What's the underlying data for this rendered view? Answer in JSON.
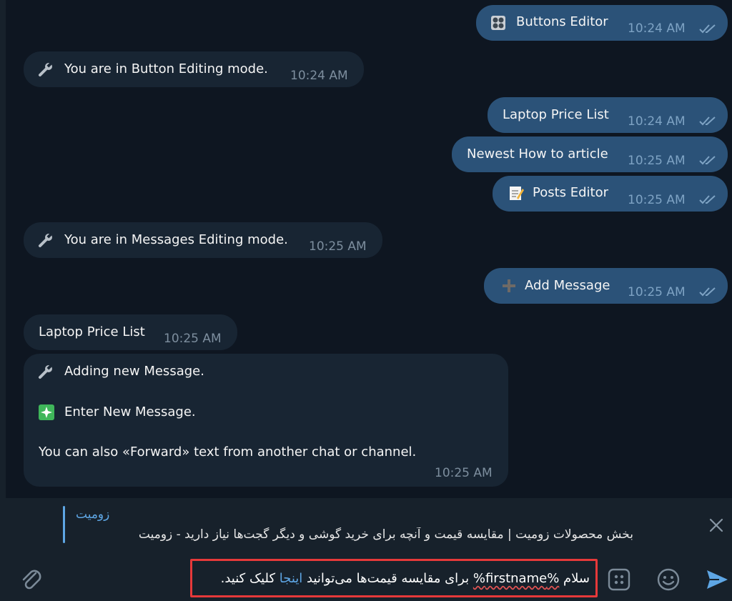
{
  "messages": {
    "buttons_editor": {
      "label": "Buttons Editor",
      "time": "10:24 AM",
      "icon": "control-knobs-icon"
    },
    "button_mode": {
      "label": "You are in Button Editing mode.",
      "time": "10:24 AM",
      "icon": "wrench-icon"
    },
    "laptop_out": {
      "label": "Laptop Price List",
      "time": "10:24 AM"
    },
    "howto": {
      "label": "Newest How to article",
      "time": "10:25 AM"
    },
    "posts_editor": {
      "label": "Posts Editor",
      "time": "10:25 AM",
      "icon": "memo-icon"
    },
    "messages_mode": {
      "label": "You are in Messages Editing mode.",
      "time": "10:25 AM",
      "icon": "wrench-icon"
    },
    "add_message": {
      "label": "Add Message",
      "time": "10:25 AM",
      "icon": "plus-icon"
    },
    "laptop_in": {
      "label": "Laptop Price List",
      "time": "10:25 AM"
    },
    "adding": {
      "line1": "Adding new Message.",
      "line2": "Enter New Message.",
      "line3": "You can also «Forward» text from another chat or channel.",
      "time": "10:25 AM",
      "icon1": "wrench-icon",
      "icon2": "sparkles-icon"
    }
  },
  "reply": {
    "name": "زومیت",
    "text": "بخش محصولات زومیت | مقایسه قیمت و آنچه برای خرید گوشی و دیگر گجت‌ها نیاز دارید  - زومیت"
  },
  "composer": {
    "part1": "سلام ",
    "var": "%firstname%",
    "part2": " برای مقایسه قیمت‌ها می‌توانید ",
    "link": "اینجا",
    "part3": " کلیک کنید."
  },
  "colors": {
    "background": "#0e1621",
    "incoming": "#182533",
    "outgoing": "#2b5278",
    "accent": "#5ea6e4",
    "highlight_border": "#e6393a"
  }
}
